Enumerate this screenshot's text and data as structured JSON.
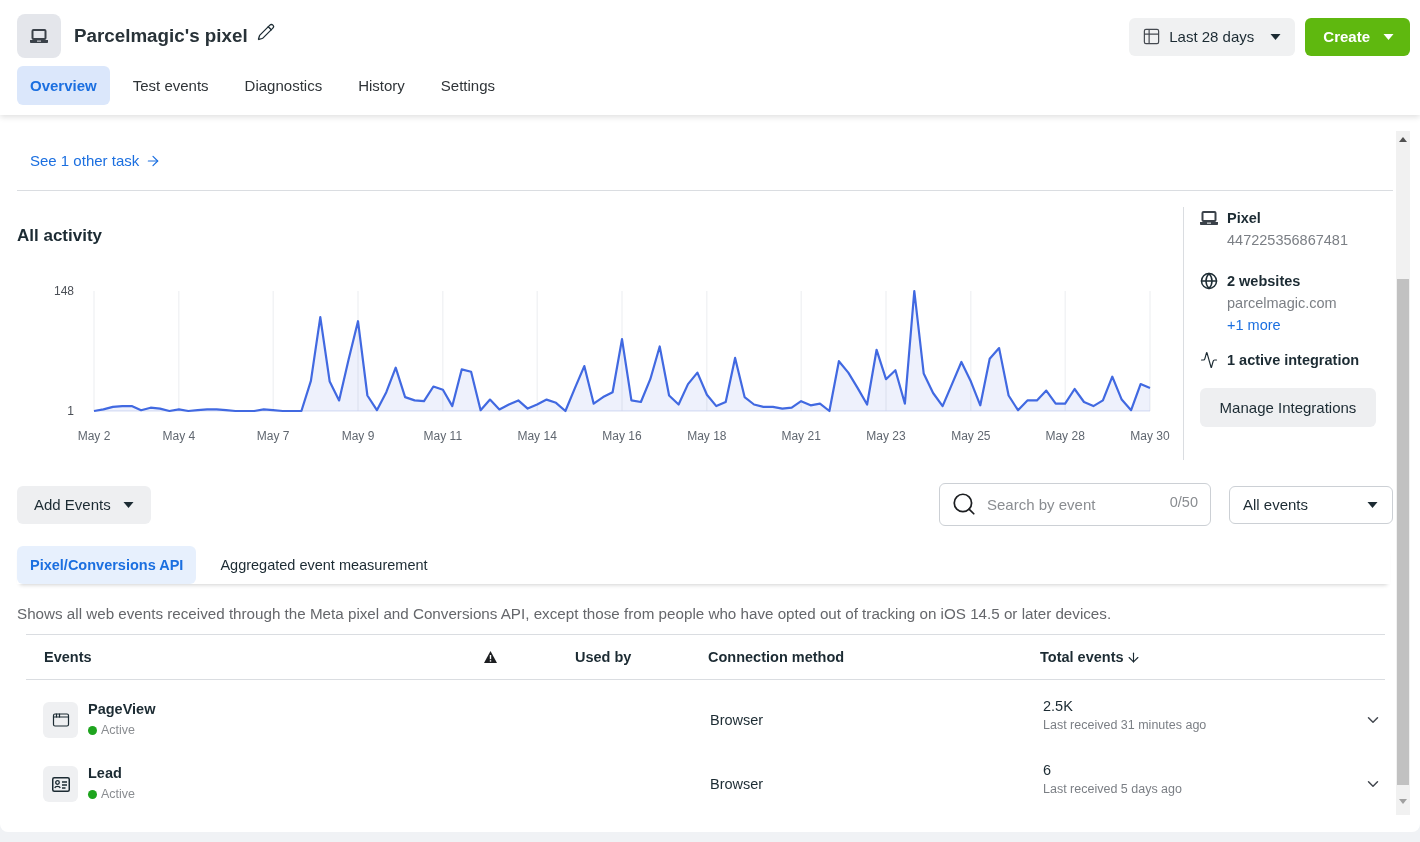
{
  "header": {
    "title": "Parcelmagic's pixel",
    "date_range": "Last 28 days",
    "create_button": "Create"
  },
  "tabs": [
    {
      "label": "Overview",
      "selected": true
    },
    {
      "label": "Test events",
      "selected": false
    },
    {
      "label": "Diagnostics",
      "selected": false
    },
    {
      "label": "History",
      "selected": false
    },
    {
      "label": "Settings",
      "selected": false
    }
  ],
  "task_link": "See 1 other task",
  "activity": {
    "title": "All activity",
    "chart_data": {
      "type": "area",
      "categories": [
        "May 2",
        null,
        null,
        null,
        null,
        null,
        null,
        null,
        null,
        "May 4",
        null,
        null,
        null,
        null,
        null,
        null,
        null,
        null,
        null,
        "May 7",
        null,
        null,
        null,
        null,
        null,
        null,
        null,
        null,
        "May 9",
        null,
        null,
        null,
        null,
        null,
        null,
        null,
        null,
        "May 11",
        null,
        null,
        null,
        null,
        null,
        null,
        null,
        null,
        null,
        "May 14",
        null,
        null,
        null,
        null,
        null,
        null,
        null,
        null,
        "May 16",
        null,
        null,
        null,
        null,
        null,
        null,
        null,
        null,
        "May 18",
        null,
        null,
        null,
        null,
        null,
        null,
        null,
        null,
        null,
        "May 21",
        null,
        null,
        null,
        null,
        null,
        null,
        null,
        null,
        "May 23",
        null,
        null,
        null,
        null,
        null,
        null,
        null,
        null,
        "May 25",
        null,
        null,
        null,
        null,
        null,
        null,
        null,
        null,
        null,
        "May 28",
        null,
        null,
        null,
        null,
        null,
        null,
        null,
        null,
        "May 30"
      ],
      "series": [
        {
          "color": "#4169e1",
          "values": [
            1,
            3,
            6,
            7,
            7,
            2,
            5,
            4,
            1,
            3,
            1,
            2,
            3,
            3,
            2,
            1,
            1,
            1,
            3,
            2,
            1,
            1,
            1,
            38,
            116,
            37,
            14,
            64,
            111,
            20,
            2,
            24,
            54,
            18,
            14,
            13,
            31,
            27,
            7,
            52,
            49,
            2,
            15,
            3,
            9,
            14,
            4,
            9,
            15,
            11,
            1,
            29,
            56,
            10,
            18,
            24,
            89,
            14,
            12,
            40,
            80,
            20,
            9,
            34,
            48,
            21,
            7,
            12,
            66,
            18,
            9,
            6,
            6,
            4,
            5,
            13,
            8,
            10,
            1,
            62,
            48,
            29,
            9,
            76,
            40,
            51,
            10,
            148,
            47,
            23,
            7,
            34,
            61,
            37,
            8,
            65,
            78,
            20,
            2,
            14,
            14,
            26,
            10,
            10,
            28,
            12,
            7,
            14,
            43,
            15,
            2,
            34,
            29
          ]
        }
      ],
      "ylim": [
        1,
        148
      ],
      "yticks": [
        1,
        148
      ],
      "grid": true
    },
    "details": {
      "pixel": {
        "title": "Pixel",
        "id": "447225356867481"
      },
      "websites": {
        "title": "2 websites",
        "domain": "parcelmagic.com",
        "more_link": "+1 more"
      },
      "integrations": {
        "title": "1 active integration"
      },
      "manage_button": "Manage Integrations"
    }
  },
  "toolbar": {
    "add_events": "Add Events",
    "search": {
      "placeholder": "Search by event",
      "counter": "0/50"
    },
    "filter": "All events"
  },
  "event_tabs": [
    {
      "label": "Pixel/Conversions API",
      "selected": true
    },
    {
      "label": "Aggregated event measurement",
      "selected": false
    }
  ],
  "description": "Shows all web events received through the Meta pixel and Conversions API, except those from people who have opted out of tracking on iOS 14.5 or later devices.",
  "events_table": {
    "columns": [
      {
        "kind": "text",
        "label": "Events",
        "sorted": false
      },
      {
        "kind": "warning",
        "sorted": false
      },
      {
        "kind": "text",
        "label": "Used by",
        "sorted": false
      },
      {
        "kind": "text",
        "label": "Connection method",
        "sorted": false
      },
      {
        "kind": "text",
        "label": "Total events",
        "sorted": true
      }
    ],
    "rows": [
      {
        "kind": "page",
        "name": "PageView",
        "status": {
          "label": "Active",
          "color": "#1ea41e"
        },
        "connection": "Browser",
        "total": "2.5K",
        "last_received": "Last received 31 minutes ago",
        "expanded": false
      },
      {
        "kind": "contact",
        "name": "Lead",
        "status": {
          "label": "Active",
          "color": "#1ea41e"
        },
        "connection": "Browser",
        "total": "6",
        "last_received": "Last received 5 days ago",
        "expanded": false
      }
    ]
  }
}
